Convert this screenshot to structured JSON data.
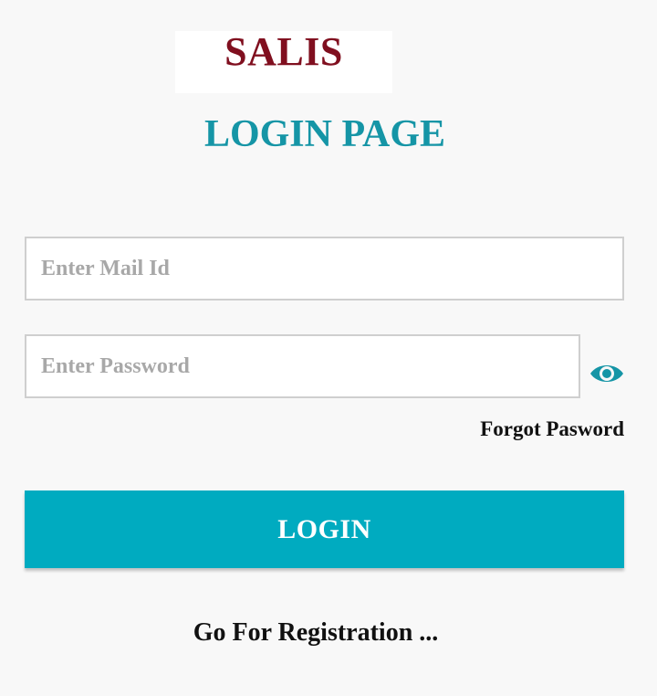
{
  "app": {
    "name": "SALIS"
  },
  "page": {
    "title": "LOGIN PAGE"
  },
  "form": {
    "email_placeholder": "Enter Mail Id",
    "email_value": "",
    "password_placeholder": "Enter Password",
    "password_value": "",
    "show_password_icon": "eye-icon",
    "forgot_label": "Forgot Pasword",
    "login_label": "LOGIN"
  },
  "footer": {
    "register_label": "Go For Registration ..."
  },
  "colors": {
    "brand": "#800f1f",
    "accent": "#1595a6",
    "button": "#00abc0",
    "background": "#f8f8f8"
  }
}
